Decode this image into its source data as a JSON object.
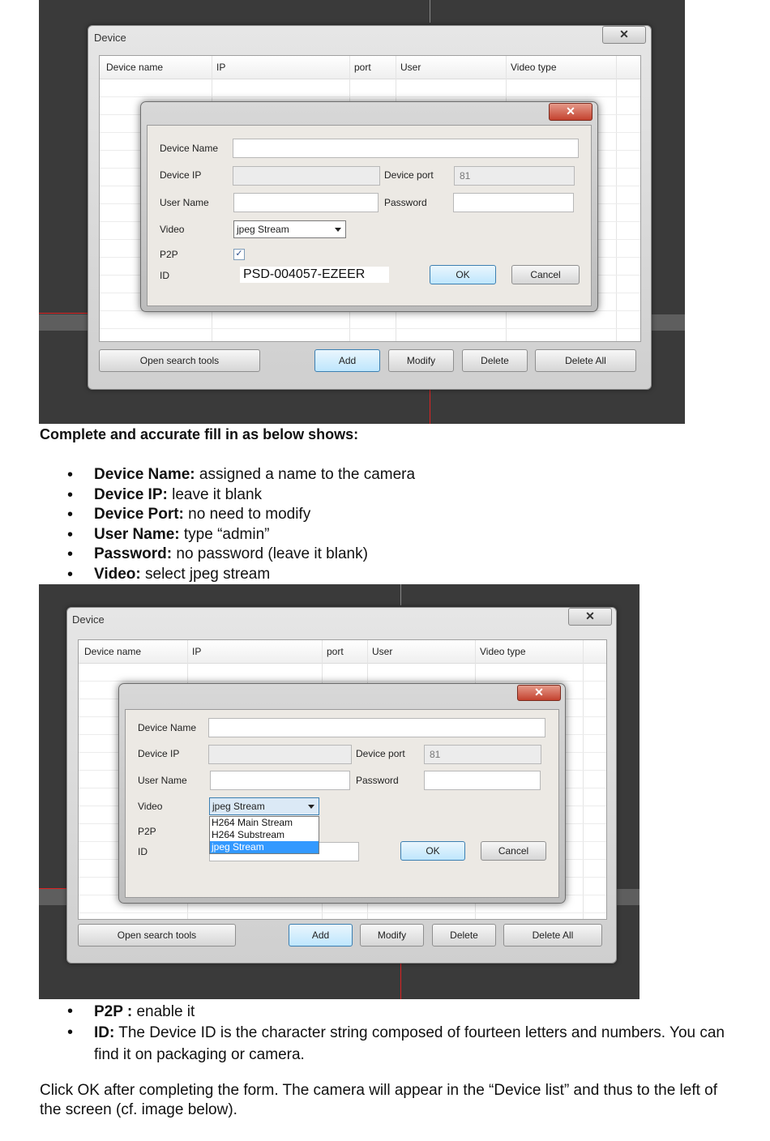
{
  "dialog_common": {
    "window_title": "Device",
    "close_glyph": "✕",
    "columns": [
      "Device name",
      "IP",
      "port",
      "User",
      "Video type"
    ],
    "labels": {
      "device_name": "Device Name",
      "device_ip": "Device IP",
      "device_port": "Device port",
      "user_name": "User Name",
      "password": "Password",
      "video": "Video",
      "p2p": "P2P",
      "id": "ID"
    },
    "port_value": "81",
    "video_selected": "jpeg Stream",
    "buttons": {
      "ok": "OK",
      "cancel": "Cancel",
      "open_search": "Open search tools",
      "add": "Add",
      "modify": "Modify",
      "delete": "Delete",
      "delete_all": "Delete All"
    },
    "checkmark": "✓"
  },
  "screenshot1": {
    "id_value": "PSD-004057-EZEER",
    "p2p_checked": true
  },
  "screenshot2": {
    "dropdown_options": [
      "H264 Main Stream",
      "H264 Substream",
      "jpeg Stream"
    ],
    "dropdown_selected_index": 2
  },
  "caption": "Complete and accurate fill in as below shows:",
  "bullets1": [
    {
      "term": "Device Name:",
      "text": " assigned a name to the camera"
    },
    {
      "term": "Device IP:",
      "text": " leave it blank"
    },
    {
      "term": "Device Port:",
      "text": " no need to modify"
    },
    {
      "term": "User Name:",
      "text": " type “admin”"
    },
    {
      "term": "Password:",
      "text": " no password (leave it blank)"
    },
    {
      "term": "Video:",
      "text": " select jpeg stream"
    }
  ],
  "bullets2": [
    {
      "term": "P2P :",
      "text": " enable it"
    },
    {
      "term": "ID:",
      "text": " The Device ID is the character string composed of fourteen letters and numbers. You can find it on packaging or camera."
    }
  ],
  "final_paragraph": "Click OK after completing the form. The camera will appear in the “Device list” and thus to the left of the screen (cf. image below)."
}
